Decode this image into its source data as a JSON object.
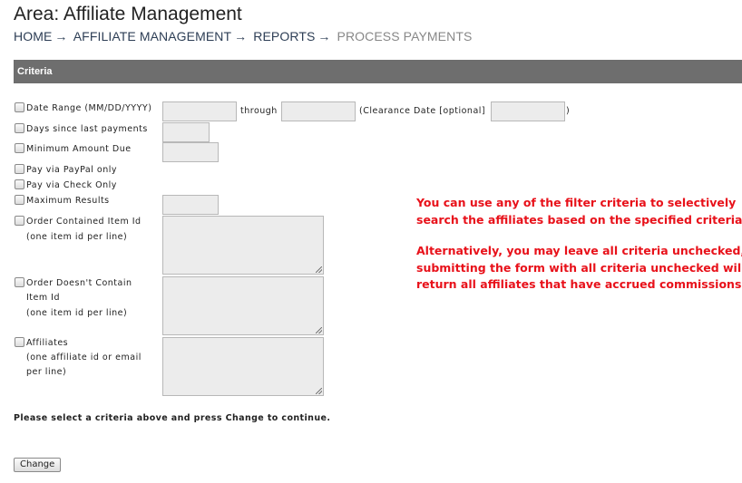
{
  "header": {
    "title": "Area: Affiliate Management",
    "breadcrumb": [
      {
        "label": "HOME"
      },
      {
        "label": "AFFILIATE MANAGEMENT"
      },
      {
        "label": "REPORTS"
      },
      {
        "label": "PROCESS PAYMENTS"
      }
    ],
    "separator": "→"
  },
  "section": {
    "title": "Criteria"
  },
  "form": {
    "date_range_label": "Date Range (MM/DD/YYYY)",
    "through_label": "through",
    "clearance_label": "(Clearance Date [optional]",
    "clearance_close": ")",
    "days_since_label": "Days since last payments",
    "min_amount_label": "Minimum Amount Due",
    "paypal_label": "Pay via PayPal only",
    "check_label": "Pay via Check Only",
    "max_results_label": "Maximum Results",
    "order_contained_label": "Order Contained Item Id",
    "order_contained_hint": "(one item id per line)",
    "order_not_contain_label1": "Order Doesn't Contain",
    "order_not_contain_label2": "Item Id",
    "order_not_contain_hint": "(one item id per line)",
    "affiliates_label": "Affiliates",
    "affiliates_hint1": "(one affiliate id or email",
    "affiliates_hint2": "per line)"
  },
  "help": {
    "line1": "You can use any of the filter criteria to selectively",
    "line2": "search the affiliates based on the specified criteria.",
    "line3": "Alternatively, you may leave all criteria unchecked,",
    "line4": "submitting the form with all criteria unchecked will",
    "line5": "return all affiliates that have accrued commissions.",
    "color": "#e8111a"
  },
  "instruction": "Please select a criteria above and press Change to continue.",
  "change_button": "Change"
}
